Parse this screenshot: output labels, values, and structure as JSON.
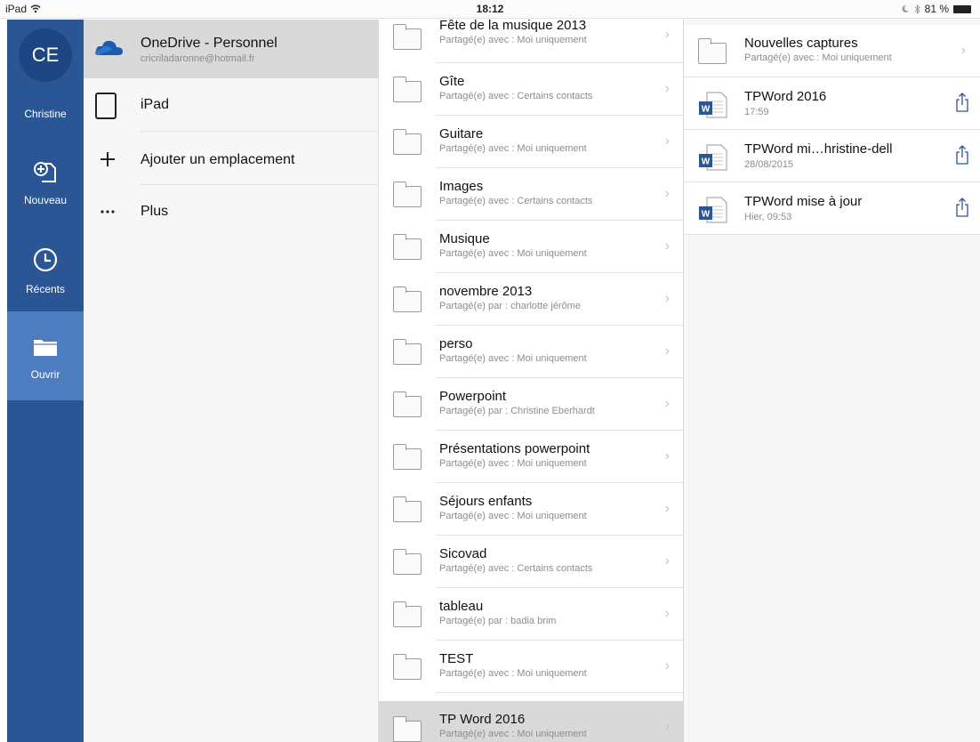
{
  "status_bar": {
    "device": "iPad",
    "time": "18:12",
    "battery": "81 %"
  },
  "rail": {
    "user_initials": "CE",
    "user_name": "Christine",
    "items": [
      {
        "label": "Nouveau",
        "icon": "new-document-icon"
      },
      {
        "label": "Récents",
        "icon": "clock-icon"
      },
      {
        "label": "Ouvrir",
        "icon": "folder-icon"
      }
    ],
    "colors": {
      "background": "#2a5696",
      "active": "#4e7dbf"
    }
  },
  "locations": {
    "onedrive": {
      "title": "OneDrive - Personnel",
      "subtitle": "cricriladaronne@hotmail.fr",
      "icon": "onedrive-cloud-icon"
    },
    "ipad": {
      "title": "iPad",
      "icon": "ipad-icon"
    },
    "add": {
      "title": "Ajouter un emplacement",
      "icon": "plus-icon"
    },
    "more": {
      "title": "Plus",
      "icon": "ellipsis-icon"
    }
  },
  "folders": [
    {
      "name": "Fête de la musique 2013",
      "sharing": "Partagé(e) avec : Moi uniquement"
    },
    {
      "name": "Gîte",
      "sharing": "Partagé(e) avec : Certains contacts"
    },
    {
      "name": "Guitare",
      "sharing": "Partagé(e) avec : Moi uniquement"
    },
    {
      "name": "Images",
      "sharing": "Partagé(e) avec : Certains contacts"
    },
    {
      "name": "Musique",
      "sharing": "Partagé(e) avec : Moi uniquement"
    },
    {
      "name": "novembre 2013",
      "sharing": "Partagé(e) par : charlotte jérôme"
    },
    {
      "name": "perso",
      "sharing": "Partagé(e) avec : Moi uniquement"
    },
    {
      "name": "Powerpoint",
      "sharing": "Partagé(e) par : Christine Eberhardt"
    },
    {
      "name": "Présentations powerpoint",
      "sharing": "Partagé(e) avec : Moi uniquement"
    },
    {
      "name": "Séjours enfants",
      "sharing": "Partagé(e) avec : Moi uniquement"
    },
    {
      "name": "Sicovad",
      "sharing": "Partagé(e) avec : Certains contacts"
    },
    {
      "name": "tableau",
      "sharing": "Partagé(e) par : badia brim"
    },
    {
      "name": "TEST",
      "sharing": "Partagé(e) avec : Moi uniquement"
    },
    {
      "name": "TP Word 2016",
      "sharing": "Partagé(e) avec : Moi uniquement",
      "selected": true
    }
  ],
  "files": [
    {
      "name": "Nouvelles captures",
      "meta": "Partagé(e) avec : Moi uniquement",
      "kind": "folder"
    },
    {
      "name": "TPWord 2016",
      "meta": "17:59",
      "kind": "word"
    },
    {
      "name": "TPWord mi…hristine-dell",
      "meta": "28/08/2015",
      "kind": "word"
    },
    {
      "name": "TPWord mise à jour",
      "meta": "Hier, 09:53",
      "kind": "word"
    }
  ]
}
